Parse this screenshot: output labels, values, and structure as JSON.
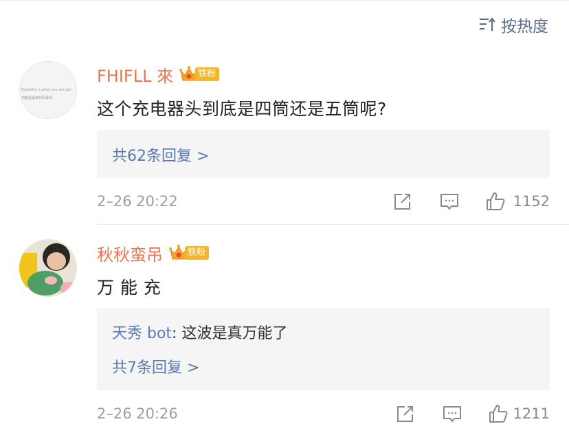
{
  "sort": {
    "label": "按热度",
    "icon": "sort-icon"
  },
  "fan_badge": "铁粉",
  "comments": [
    {
      "name": "FHIFLL 來",
      "avatar_text_1": "Beautiful is what you see girl",
      "avatar_text_2": "何能是最美的风景线",
      "text": "这个充电器头到底是四筒还是五筒呢?",
      "replies_more": "共62条回复 >",
      "time": "2–26 20:22",
      "likes": "1152"
    },
    {
      "name": "秋秋蛮吊",
      "text": "万 能 充",
      "reply_user": "天秀 bot",
      "reply_text": ": 这波是真万能了",
      "replies_more": "共7条回复 >",
      "time": "2–26 20:26",
      "likes": "1211"
    }
  ],
  "colors": {
    "name": "#eb7350",
    "link": "#5b7ab0",
    "badge": "#f7b52c"
  }
}
